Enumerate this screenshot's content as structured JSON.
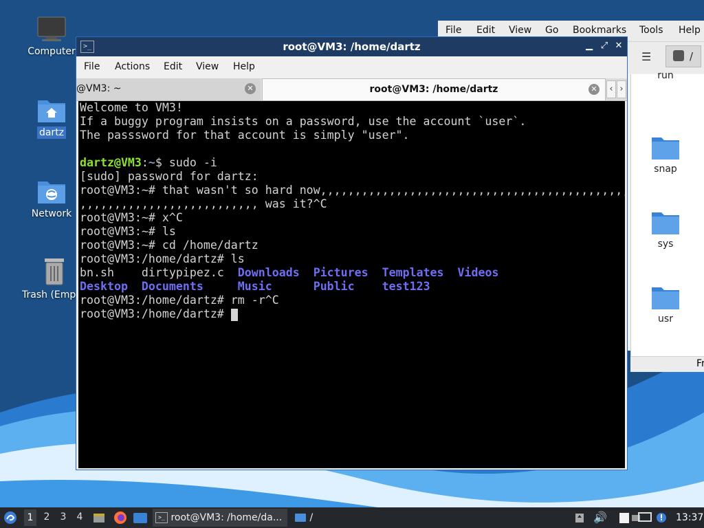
{
  "desktop": {
    "icons": [
      {
        "label": "Computer"
      },
      {
        "label": "dartz"
      },
      {
        "label": "Network"
      },
      {
        "label": "Trash (Empty)"
      }
    ]
  },
  "file_manager": {
    "menu": [
      "File",
      "Edit",
      "View",
      "Go",
      "Bookmarks",
      "Tools",
      "Help"
    ],
    "path": "/",
    "partial_folder": "run",
    "folders": [
      "snap",
      "sys",
      "usr"
    ],
    "status_partial": "Fr"
  },
  "terminal": {
    "title": "root@VM3: /home/dartz",
    "menu": [
      "File",
      "Actions",
      "Edit",
      "View",
      "Help"
    ],
    "tabs": [
      {
        "label": "@VM3: ~"
      },
      {
        "label": "root@VM3: /home/dartz"
      }
    ],
    "lines": {
      "l1": "Welcome to VM3!",
      "l2": "If a buggy program insists on a password, use the account `user`.",
      "l3": "The passsword for that account is simply \"user\".",
      "l5_user": "dartz@VM3",
      "l5_colon": ":",
      "l5_path": "~",
      "l5_cmd": "$ sudo -i",
      "l6": "[sudo] password for dartz:",
      "l7": "root@VM3:~# that wasn't so hard now,,,,,,,,,,,,,,,,,,,,,,,,,,,,,,,,,,,,,,,,,,,,,,",
      "l8": ",,,,,,,,,,,,,,,,,,,,,,,,,, was it?^C",
      "l9": "root@VM3:~# x^C",
      "l10": "root@VM3:~# ls",
      "l11": "root@VM3:~# cd /home/dartz",
      "l12": "root@VM3:/home/dartz# ls",
      "l15": "root@VM3:/home/dartz# rm -r^C",
      "l16": "root@VM3:/home/dartz# "
    },
    "ls_output": {
      "row1": [
        {
          "name": "bn.sh",
          "type": "file"
        },
        {
          "name": "dirtypipez.c",
          "type": "file"
        },
        {
          "name": "Downloads",
          "type": "dir"
        },
        {
          "name": "Pictures",
          "type": "dir"
        },
        {
          "name": "Templates",
          "type": "dir"
        },
        {
          "name": "Videos",
          "type": "dir"
        }
      ],
      "row2": [
        {
          "name": "Desktop",
          "type": "dir"
        },
        {
          "name": "Documents",
          "type": "dir"
        },
        {
          "name": "Music",
          "type": "dir"
        },
        {
          "name": "Public",
          "type": "dir"
        },
        {
          "name": "test123",
          "type": "dir"
        }
      ]
    }
  },
  "taskbar": {
    "workspaces": [
      "1",
      "2",
      "3",
      "4"
    ],
    "tasks": [
      {
        "label": "root@VM3: /home/da...",
        "icon": "terminal-icon"
      },
      {
        "label": "/",
        "icon": "folder-icon"
      }
    ],
    "clock": "13:37"
  },
  "colors": {
    "desktop_bg": "#1b4f86",
    "title_bar": "#1e3c63",
    "prompt_user": "#8ae234",
    "prompt_path": "#729fcf",
    "ls_dir": "#6f6ff5",
    "folder": "#4a8fdc"
  }
}
